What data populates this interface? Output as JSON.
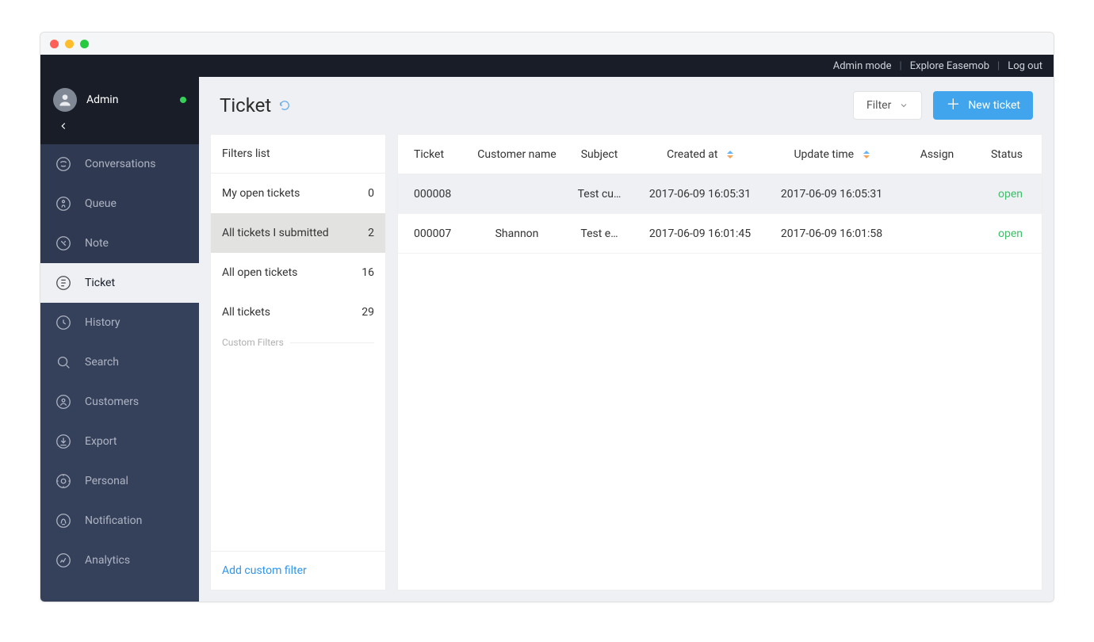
{
  "topbar": {
    "admin_mode": "Admin mode",
    "explore": "Explore Easemob",
    "logout": "Log out"
  },
  "profile": {
    "username": "Admin"
  },
  "sidebar": {
    "items": [
      {
        "key": "conversations",
        "label": "Conversations"
      },
      {
        "key": "queue",
        "label": "Queue"
      },
      {
        "key": "note",
        "label": "Note"
      },
      {
        "key": "ticket",
        "label": "Ticket"
      },
      {
        "key": "history",
        "label": "History"
      },
      {
        "key": "search",
        "label": "Search"
      },
      {
        "key": "customers",
        "label": "Customers"
      },
      {
        "key": "export",
        "label": "Export"
      },
      {
        "key": "personal",
        "label": "Personal"
      },
      {
        "key": "notification",
        "label": "Notification"
      },
      {
        "key": "analytics",
        "label": "Analytics"
      }
    ],
    "active": "ticket"
  },
  "page": {
    "title": "Ticket",
    "filter_button": "Filter",
    "new_ticket_button": "New ticket"
  },
  "filters": {
    "header": "Filters list",
    "custom_label": "Custom Filters",
    "add_custom": "Add custom filter",
    "items": [
      {
        "label": "My open tickets",
        "count": "0"
      },
      {
        "label": "All tickets I submitted",
        "count": "2"
      },
      {
        "label": "All open tickets",
        "count": "16"
      },
      {
        "label": "All tickets",
        "count": "29"
      }
    ],
    "selected_index": 1
  },
  "table": {
    "columns": {
      "ticket": "Ticket",
      "customer": "Customer name",
      "subject": "Subject",
      "created": "Created at",
      "updated": "Update time",
      "assign": "Assign",
      "status": "Status"
    },
    "rows": [
      {
        "ticket": "000008",
        "customer": "",
        "subject": "Test cu…",
        "created": "2017-06-09 16:05:31",
        "updated": "2017-06-09 16:05:31",
        "assign": "",
        "status": "open",
        "hover": true
      },
      {
        "ticket": "000007",
        "customer": "Shannon",
        "subject": "Test e…",
        "created": "2017-06-09 16:01:45",
        "updated": "2017-06-09 16:01:58",
        "assign": "",
        "status": "open",
        "hover": false
      }
    ]
  },
  "colors": {
    "primary": "#40a5ed",
    "status_open": "#3fbf6a",
    "sidebar_bg": "#35405b"
  }
}
